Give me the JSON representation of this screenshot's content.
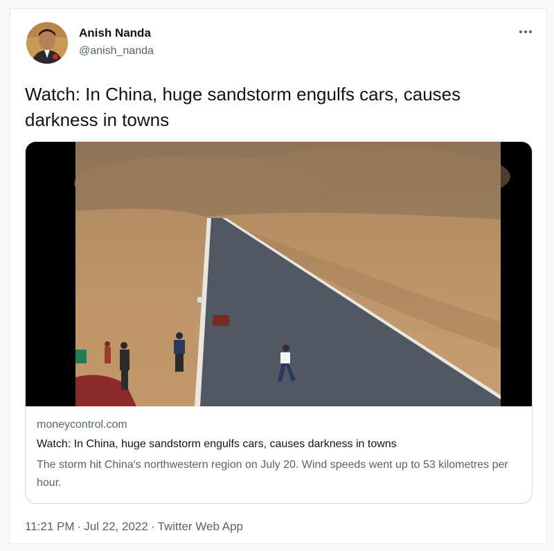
{
  "author": {
    "name": "Anish Nanda",
    "handle": "@anish_nanda"
  },
  "tweet": {
    "text": "Watch: In China, huge sandstorm engulfs cars, causes darkness in towns"
  },
  "link_card": {
    "domain": "moneycontrol.com",
    "title": "Watch: In China, huge sandstorm engulfs cars, causes darkness in towns",
    "description": "The storm hit China's northwestern region on July 20. Wind speeds went up to 53 kilometres per hour."
  },
  "meta": {
    "time": "11:21 PM",
    "separator": "·",
    "date": "Jul 22, 2022",
    "source": "Twitter Web App"
  },
  "colors": {
    "text_primary": "#0f1419",
    "text_secondary": "#536471",
    "border": "#cfd9de"
  },
  "icons": {
    "more": "more-horizontal-icon"
  }
}
